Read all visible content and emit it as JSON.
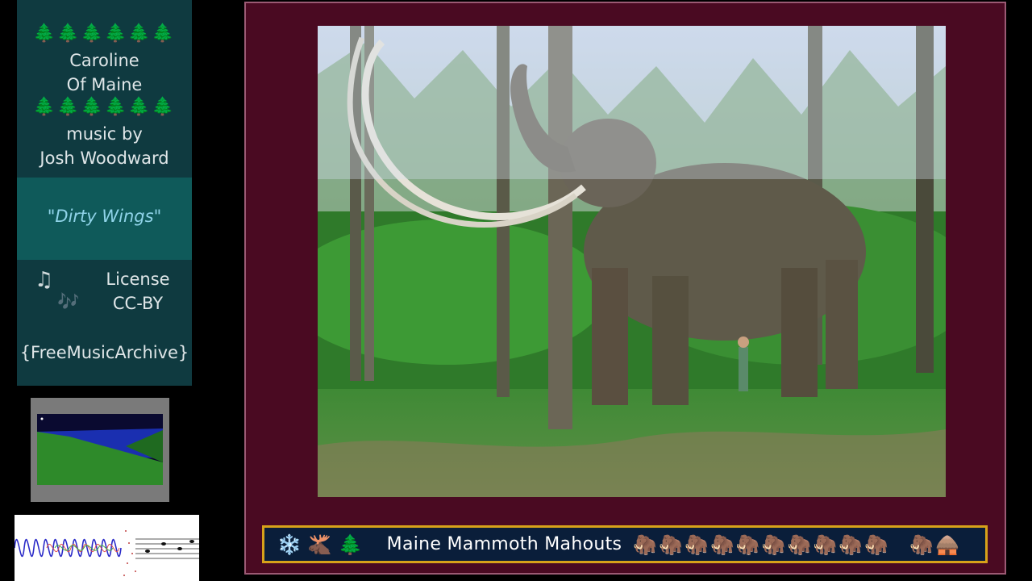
{
  "sidebar": {
    "tree_row_top": "🌲🌲🌲🌲🌲🌲",
    "artist_line1": "Caroline",
    "artist_line2": "Of Maine",
    "tree_row_bottom": "🌲🌲🌲🌲🌲🌲",
    "credit_line1": "music by",
    "credit_line2": "Josh Woodward",
    "song_title": "\"Dirty Wings\"",
    "note_icon_1": "♫",
    "note_icon_2": "🎶",
    "license_line1": "License",
    "license_line2": "CC-BY",
    "source": "{FreeMusicArchive}"
  },
  "banner": {
    "left_icons": [
      "❄️",
      "🫎",
      "🌲"
    ],
    "title": "Maine Mammoth Mahouts",
    "mammoth_icons": [
      "🦣",
      "🦣",
      "🦣",
      "🦣",
      "🦣",
      "🦣",
      "🦣",
      "🦣",
      "🦣",
      "🦣"
    ],
    "end_icons": [
      "🦣",
      "🛖"
    ]
  },
  "colors": {
    "panel_bg": "#0f3a40",
    "song_box_bg": "#0f5a5a",
    "frame_bg": "#4a0a22",
    "banner_border": "#d7a21a",
    "banner_bg": "#0a1e3a"
  }
}
